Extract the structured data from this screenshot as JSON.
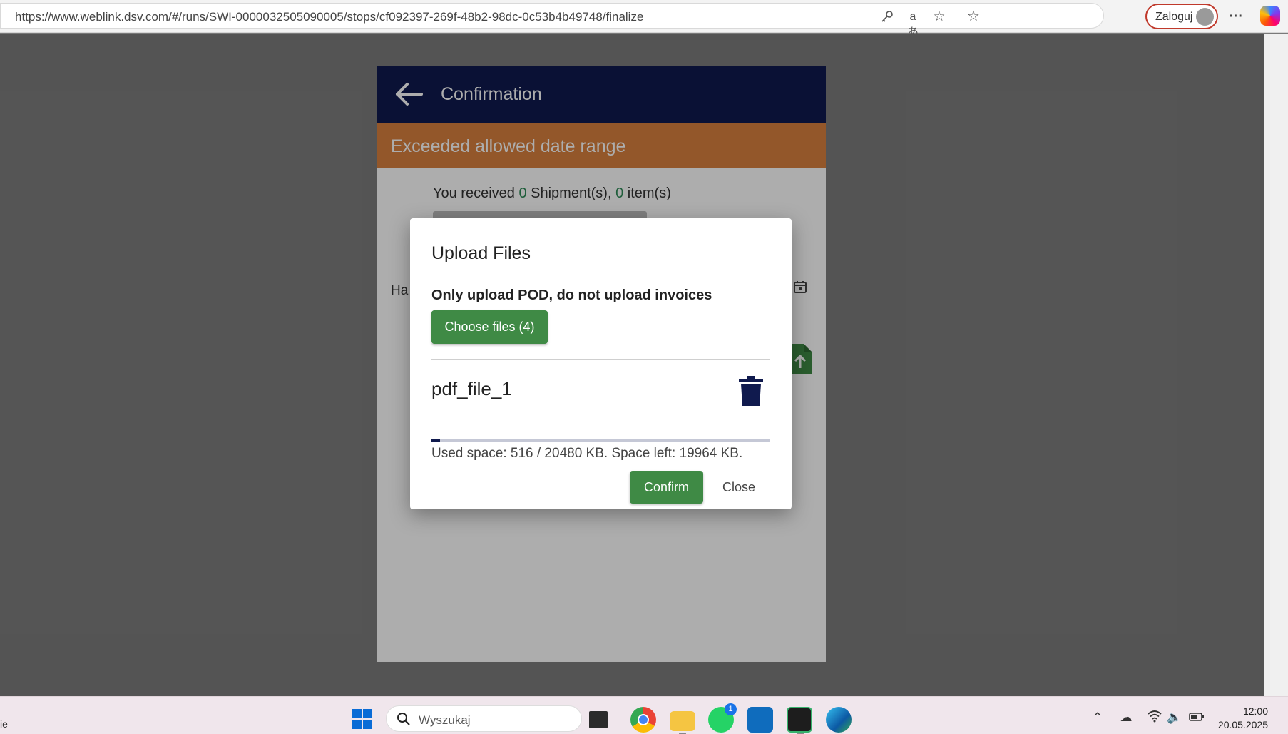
{
  "browser": {
    "url": "https://www.weblink.dsv.com/#/runs/SWI-0000032505090005/stops/cf092397-269f-48b2-98dc-0c53b4b49748/finalize",
    "login_label": "Zaloguj",
    "icons": [
      "key-icon",
      "read-aloud-icon",
      "favorite-star-icon",
      "favorites-list-icon",
      "more-menu-icon",
      "copilot-icon"
    ]
  },
  "app": {
    "title": "Confirmation",
    "warning": "Exceeded allowed date range",
    "received": {
      "prefix": "You received ",
      "shipments": "0",
      "mid": " Shipment(s), ",
      "items": "0",
      "suffix": " item(s)"
    },
    "field_label_partial": "Ha",
    "colors": {
      "header": "#101a4e",
      "warning": "#d9813e",
      "accent": "#3f8a45"
    }
  },
  "modal": {
    "title": "Upload Files",
    "note": "Only upload POD, do not upload invoices",
    "choose_label": "Choose files (4)",
    "file_name": "pdf_file_1",
    "used_text": "Used space: 516 / 20480 KB. Space left: 19964 KB.",
    "used_fraction": 0.0252,
    "confirm_label": "Confirm",
    "close_label": "Close"
  },
  "taskbar": {
    "left_fragment": "ie",
    "search_placeholder": "Wyszukaj",
    "whatsapp_badge": "1",
    "time": "12:00",
    "date": "20.05.2025"
  }
}
